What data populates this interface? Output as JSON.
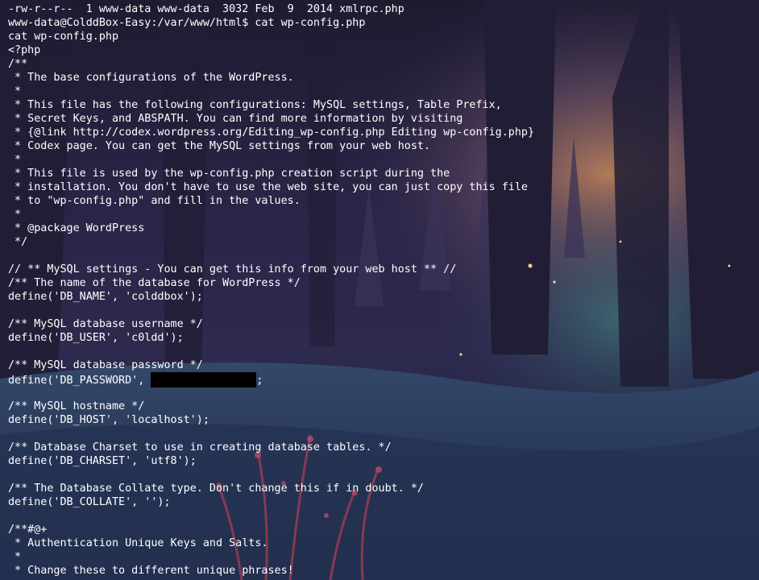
{
  "terminal": {
    "lines": [
      "-rw-r--r--  1 www-data www-data  3032 Feb  9  2014 xmlrpc.php",
      "www-data@ColddBox-Easy:/var/www/html$ cat wp-config.php",
      "cat wp-config.php",
      "<?php",
      "/**",
      " * The base configurations of the WordPress.",
      " *",
      " * This file has the following configurations: MySQL settings, Table Prefix,",
      " * Secret Keys, and ABSPATH. You can find more information by visiting",
      " * {@link http://codex.wordpress.org/Editing_wp-config.php Editing wp-config.php}",
      " * Codex page. You can get the MySQL settings from your web host.",
      " *",
      " * This file is used by the wp-config.php creation script during the",
      " * installation. You don't have to use the web site, you can just copy this file",
      " * to \"wp-config.php\" and fill in the values.",
      " *",
      " * @package WordPress",
      " */",
      "",
      "// ** MySQL settings - You can get this info from your web host ** //",
      "/** The name of the database for WordPress */",
      "define('DB_NAME', 'colddbox');",
      "",
      "/** MySQL database username */",
      "define('DB_USER', 'c0ldd');",
      "",
      "/** MySQL database password */",
      "",
      "",
      "/** MySQL hostname */",
      "define('DB_HOST', 'localhost');",
      "",
      "/** Database Charset to use in creating database tables. */",
      "define('DB_CHARSET', 'utf8');",
      "",
      "/** The Database Collate type. Don't change this if in doubt. */",
      "define('DB_COLLATE', '');",
      "",
      "/**#@+",
      " * Authentication Unique Keys and Salts.",
      " *",
      " * Change these to different unique phrases!"
    ],
    "password_line": {
      "prefix": "define('DB_PASSWORD', ",
      "suffix": ";"
    }
  }
}
